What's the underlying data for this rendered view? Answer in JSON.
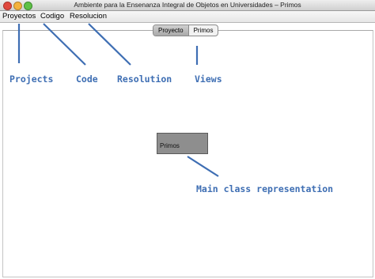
{
  "window": {
    "title": "Ambiente para la Ensenanza Integral de Objetos en Universidades – Primos"
  },
  "menu": {
    "items": [
      "Proyectos",
      "Codigo",
      "Resolucion"
    ]
  },
  "tabs": {
    "items": [
      "Proyecto",
      "Primos"
    ],
    "active": "Proyecto"
  },
  "canvas": {
    "class_box_label": "Primos"
  },
  "annotations": {
    "projects": "Projects",
    "code": "Code",
    "resolution": "Resolution",
    "views": "Views",
    "main_class": "Main class representation"
  },
  "colors": {
    "annotation": "#3e6eb3",
    "class_box": "#8e8e8e"
  }
}
